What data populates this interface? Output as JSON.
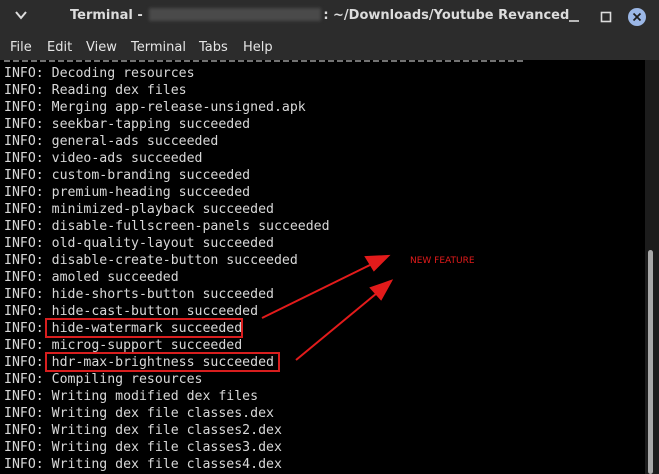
{
  "window": {
    "title_prefix": "Terminal - ",
    "title_suffix": ": ~/Downloads/Youtube Revanced"
  },
  "menu": {
    "items": [
      "File",
      "Edit",
      "View",
      "Terminal",
      "Tabs",
      "Help"
    ]
  },
  "terminal": {
    "lines": [
      "INFO: Decoding resources",
      "INFO: Reading dex files",
      "INFO: Merging app-release-unsigned.apk",
      "INFO: seekbar-tapping succeeded",
      "INFO: general-ads succeeded",
      "INFO: video-ads succeeded",
      "INFO: custom-branding succeeded",
      "INFO: premium-heading succeeded",
      "INFO: minimized-playback succeeded",
      "INFO: disable-fullscreen-panels succeeded",
      "INFO: old-quality-layout succeeded",
      "INFO: disable-create-button succeeded",
      "INFO: amoled succeeded",
      "INFO: hide-shorts-button succeeded",
      "INFO: hide-cast-button succeeded",
      "INFO: hide-watermark succeeded",
      "INFO: microg-support succeeded",
      "INFO: hdr-max-brightness succeeded",
      "INFO: Compiling resources",
      "INFO: Writing modified dex files",
      "INFO: Writing dex file classes.dex",
      "INFO: Writing dex file classes2.dex",
      "INFO: Writing dex file classes3.dex",
      "INFO: Writing dex file classes4.dex"
    ]
  },
  "annotation": {
    "label": "NEW FEATURE",
    "color": "#e31b1b"
  },
  "colors": {
    "titlebar": "#2c2c2c",
    "terminal_bg": "#000000",
    "terminal_fg": "#d8d8d8",
    "close_button": "#9bb7e6"
  },
  "icons": {
    "title_menu": "chevron-down-icon",
    "minimize": "minimize-icon",
    "maximize": "maximize-icon",
    "close": "close-icon"
  }
}
